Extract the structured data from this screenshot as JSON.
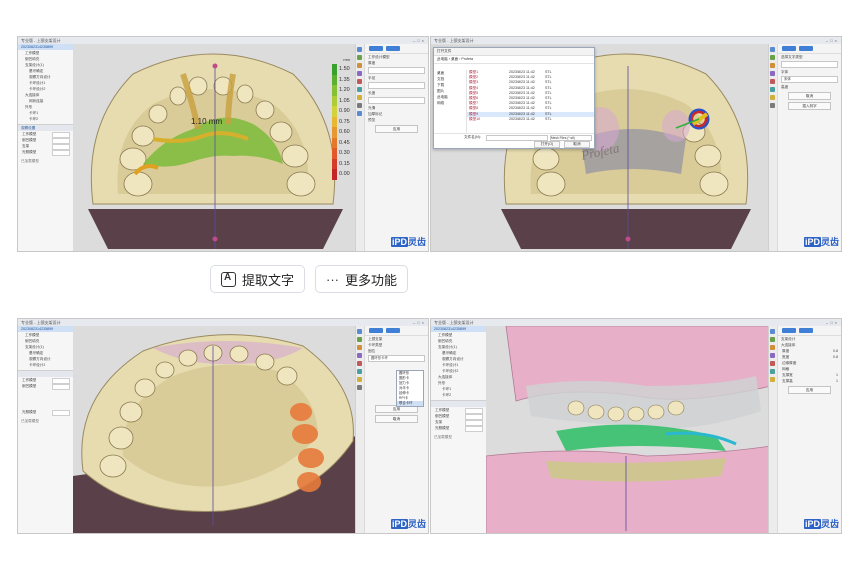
{
  "panels": [
    {
      "title": "专业版 - 上颌支架设计",
      "tree": [
        "2023082314235899",
        "工作模型",
        "倒凹填充",
        "支架设计(1)",
        "基牙确定",
        "观察方向设计",
        "卡环设计1",
        "卡环设计2",
        "大连接体",
        "网状连接",
        "外形",
        "卡环1",
        "卡环2"
      ],
      "side_section": "观察设置",
      "side_props": [
        "工作模型",
        "倒凹模型",
        "支架",
        "光照模型"
      ],
      "status": "已加载模型",
      "measurement": "1.10 mm",
      "unit": "mm",
      "scale": [
        "1.50",
        "1.35",
        "1.20",
        "1.05",
        "0.90",
        "0.75",
        "0.60",
        "0.45",
        "0.30",
        "0.15",
        "0.00"
      ],
      "right_fields": [
        "工作设计模型",
        "厚度",
        "半径",
        "长度",
        "光滑",
        "加厚标记",
        "预览"
      ],
      "right_buttons": [
        "应用"
      ],
      "logo_brand": "iPD",
      "logo_text": "灵齿"
    },
    {
      "title": "专业版 - 上颌支架设计",
      "dialog_title": "打开文件",
      "dialog_path": "此电脑 › 桌面 › Profeta",
      "dialog_side": [
        "桌面",
        "文档",
        "下载",
        "图片",
        "此电脑",
        "网络"
      ],
      "dialog_rows": [
        {
          "name": "模型1",
          "date": "2023/8/23 11:42",
          "type": "STL"
        },
        {
          "name": "模型2",
          "date": "2023/8/23 11:42",
          "type": "STL"
        },
        {
          "name": "模型3",
          "date": "2023/8/23 11:42",
          "type": "STL"
        },
        {
          "name": "模型4",
          "date": "2023/8/23 11:42",
          "type": "STL"
        },
        {
          "name": "模型5",
          "date": "2023/8/23 11:42",
          "type": "STL"
        },
        {
          "name": "模型6",
          "date": "2023/8/23 11:42",
          "type": "STL"
        },
        {
          "name": "模型7",
          "date": "2023/8/23 11:42",
          "type": "STL"
        },
        {
          "name": "模型8",
          "date": "2023/8/23 11:42",
          "type": "STL"
        },
        {
          "name": "模型9",
          "date": "2023/8/23 11:42",
          "type": "STL"
        },
        {
          "name": "模型10",
          "date": "2023/8/23 11:42",
          "type": "STL"
        }
      ],
      "dialog_filename_label": "文件名(N):",
      "dialog_filter": "Mesh Files (*.stl)",
      "dialog_open": "打开(O)",
      "dialog_cancel": "取消",
      "watermark": "Profeta",
      "right_fields": [
        "选择文字类型",
        "字体",
        "宋体",
        "高度"
      ],
      "right_buttons": [
        "取消",
        "插入刻字"
      ],
      "status": "已加载刻字模型",
      "logo_brand": "iPD",
      "logo_text": "灵齿"
    },
    {
      "title": "专业版 - 上颌支架设计",
      "tree": [
        "2023082314235899",
        "工作模型",
        "倒凹填充",
        "支架设计(1)",
        "基牙确定",
        "观察方向设计",
        "卡环设计1"
      ],
      "side_props": [
        "工作模型",
        "倒凹模型",
        "光照模型"
      ],
      "status": "已加载模型",
      "right_fields": [
        "上颌支架",
        "卡环类型",
        "固位",
        "圆环形卡环"
      ],
      "dropdown": [
        "圆环形",
        "圈形卡",
        "回力卡",
        "对半卡",
        "延伸卡",
        "RPI卡",
        "联合卡环"
      ],
      "right_buttons": [
        "应用",
        "取消"
      ],
      "logo_brand": "iPD",
      "logo_text": "灵齿"
    },
    {
      "title": "专业版 - 上颌支架设计",
      "tree": [
        "2023082314235899",
        "工作模型",
        "倒凹填充",
        "支架设计(1)",
        "基牙确定",
        "观察方向设计",
        "卡环设计1",
        "卡环设计2",
        "大连接体",
        "外形",
        "卡环1",
        "卡环2"
      ],
      "side_props": [
        "工作模型",
        "倒凹模型",
        "支架",
        "光照模型"
      ],
      "status": "已加载模型",
      "right_fields": [
        "支架设计",
        "大连接体",
        "厚度",
        "宽度",
        "边缘厚度",
        "网格",
        "支撑宽",
        "支撑高"
      ],
      "right_values": [
        "0.8",
        "0.8",
        "1",
        "1"
      ],
      "right_buttons": [
        "应用"
      ],
      "logo_brand": "iPD",
      "logo_text": "灵齿"
    }
  ],
  "toolbar": {
    "ocr_label": "提取文字",
    "more_label": "更多功能",
    "more_icon": "ellipsis-icon",
    "ocr_icon": "text-scan-icon"
  }
}
